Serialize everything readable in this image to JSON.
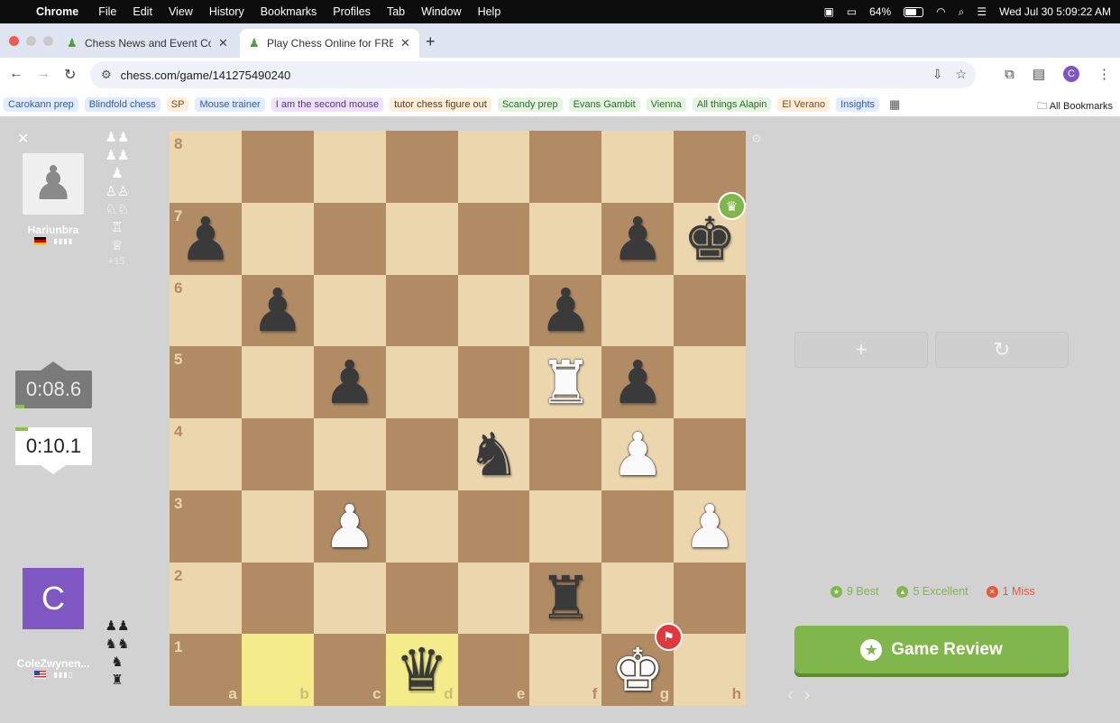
{
  "menubar": {
    "app": "Chrome",
    "items": [
      "File",
      "Edit",
      "View",
      "History",
      "Bookmarks",
      "Profiles",
      "Tab",
      "Window",
      "Help"
    ],
    "battery": "64%",
    "datetime": "Wed Jul 30  5:09:22 AM"
  },
  "tabs": [
    {
      "title": "Chess News and Event Cover"
    },
    {
      "title": "Play Chess Online for FREE -"
    }
  ],
  "address": {
    "url": "chess.com/game/141275490240"
  },
  "profile_initial": "C",
  "bookmarks": [
    {
      "label": "Carokann prep",
      "bg": "#e3ecfa",
      "fg": "#2e5aa8"
    },
    {
      "label": "Blindfold chess",
      "bg": "#e3ecfa",
      "fg": "#2e5aa8"
    },
    {
      "label": "SP",
      "bg": "#fbeedc",
      "fg": "#7a4a16"
    },
    {
      "label": "Mouse trainer",
      "bg": "#e3ecfa",
      "fg": "#2e5aa8"
    },
    {
      "label": "I am the second mouse",
      "bg": "#ece3f7",
      "fg": "#5b2f91"
    },
    {
      "label": "tutor chess figure out",
      "bg": "#fbeedc",
      "fg": "#5a3a16"
    },
    {
      "label": "Scandy prep",
      "bg": "#e5f3e3",
      "fg": "#2f6a2a"
    },
    {
      "label": "Evans Gambit",
      "bg": "#e5f3e3",
      "fg": "#2f6a2a"
    },
    {
      "label": "Vienna",
      "bg": "#e5f3e3",
      "fg": "#2f6a2a"
    },
    {
      "label": "All things Alapin",
      "bg": "#e5f3e3",
      "fg": "#2f6a2a"
    },
    {
      "label": "El Verano",
      "bg": "#fbeedc",
      "fg": "#7a4a16"
    },
    {
      "label": "Insights",
      "bg": "#e3ecfa",
      "fg": "#2e5aa8"
    }
  ],
  "all_bookmarks": "All Bookmarks",
  "top_player": {
    "name": "Hariunbra",
    "flag": "■",
    "captured": [
      "♟♟",
      "♟♟",
      "♟",
      "♙♙",
      "♘♘",
      "♖",
      "♕"
    ],
    "score": "+15",
    "clock": "0:08.6"
  },
  "bottom_player": {
    "name": "ColeZwynen...",
    "initial": "C",
    "flag": "■",
    "captured": [
      "♟♟",
      "♞♞",
      "♞",
      "♜"
    ],
    "clock": "0:10.1"
  },
  "board": {
    "ranks": [
      "8",
      "7",
      "6",
      "5",
      "4",
      "3",
      "2",
      "1"
    ],
    "files": [
      "a",
      "b",
      "c",
      "d",
      "e",
      "f",
      "g",
      "h"
    ],
    "highlight": [
      "b1",
      "d1"
    ],
    "pieces": {
      "a7": "bp",
      "g7": "bp",
      "h7": "bk",
      "b6": "bp",
      "f6": "bp",
      "c5": "bp",
      "f5": "wr",
      "g5": "bp",
      "e4": "bn",
      "g4": "wp",
      "c3": "wp",
      "h3": "wp",
      "f2": "br",
      "d1": "bq",
      "g1": "wk"
    },
    "glyphs": {
      "p": "♟",
      "r": "♜",
      "n": "♞",
      "b": "♝",
      "q": "♛",
      "k": "♚"
    }
  },
  "right_panel": {
    "add_icon": "+",
    "reset_icon": "↻",
    "stats": [
      {
        "label": "9 Best",
        "color": "#81b64c",
        "icon": "★"
      },
      {
        "label": "5 Excellent",
        "color": "#81b64c",
        "icon": "👍"
      },
      {
        "label": "1 Miss",
        "color": "#e3593b",
        "icon": "✕"
      }
    ],
    "review_label": "Game Review"
  }
}
